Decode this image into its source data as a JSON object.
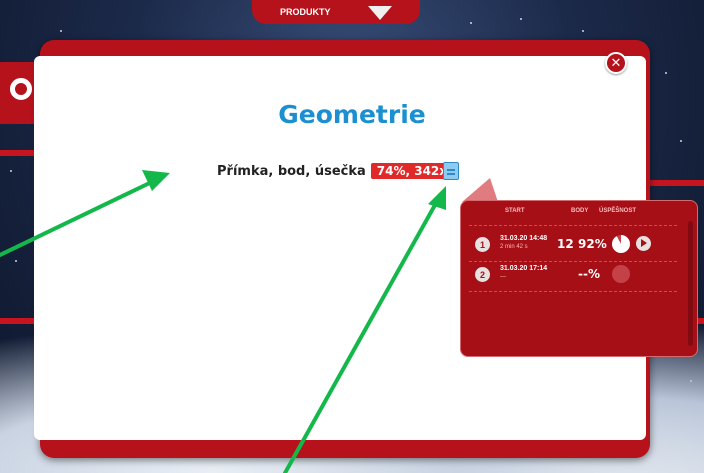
{
  "top_nav": {
    "products_label": "PRODUKTY"
  },
  "dialog": {
    "title": "Geometrie",
    "close_icon": "close-icon",
    "topic": {
      "name": "Přímka, bod, úsečka",
      "badge": "74%, 342x",
      "details_icon": "document-icon"
    }
  },
  "attempts_popup": {
    "headers": {
      "start": "START",
      "points": "BODY",
      "success": "ÚSPĚŠNOST"
    },
    "rows": [
      {
        "number": "1",
        "date": "31.03.20",
        "time": "14:48",
        "duration": "2 min 42 s",
        "points": "12",
        "success": "92%",
        "success_fraction": 0.92,
        "has_play": true
      },
      {
        "number": "2",
        "date": "31.03.20",
        "time": "17:14",
        "duration": "—",
        "points": "",
        "success": "--%",
        "success_fraction": null,
        "has_play": false
      }
    ]
  },
  "colors": {
    "brand_red": "#b5121b",
    "title_blue": "#1b8fd0",
    "badge_red": "#e02a2a",
    "annotation_green": "#14b84a"
  }
}
